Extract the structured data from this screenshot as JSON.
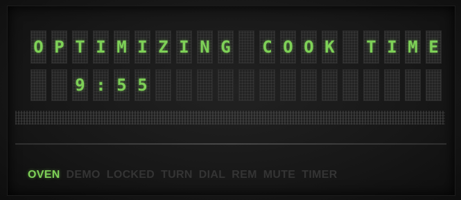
{
  "display": {
    "line1": [
      "O",
      "P",
      "T",
      "I",
      "M",
      "I",
      "Z",
      "I",
      "N",
      "G",
      "",
      "C",
      "O",
      "O",
      "K",
      "",
      "T",
      "I",
      "M",
      "E"
    ],
    "line2": [
      "",
      "",
      "9",
      ":",
      "5",
      "5",
      "",
      "",
      "",
      "",
      "",
      "",
      "",
      "",
      "",
      "",
      "",
      "",
      "",
      ""
    ]
  },
  "indicators": [
    {
      "label": "OVEN",
      "active": true
    },
    {
      "label": "DEMO",
      "active": false
    },
    {
      "label": "LOCKED",
      "active": false
    },
    {
      "label": "TURN",
      "active": false
    },
    {
      "label": "DIAL",
      "active": false
    },
    {
      "label": "REM",
      "active": false
    },
    {
      "label": "MUTE",
      "active": false
    },
    {
      "label": "TIMER",
      "active": false
    }
  ],
  "colors": {
    "lit": "#7ed157",
    "unlit": "#343434",
    "background": "#171717"
  }
}
